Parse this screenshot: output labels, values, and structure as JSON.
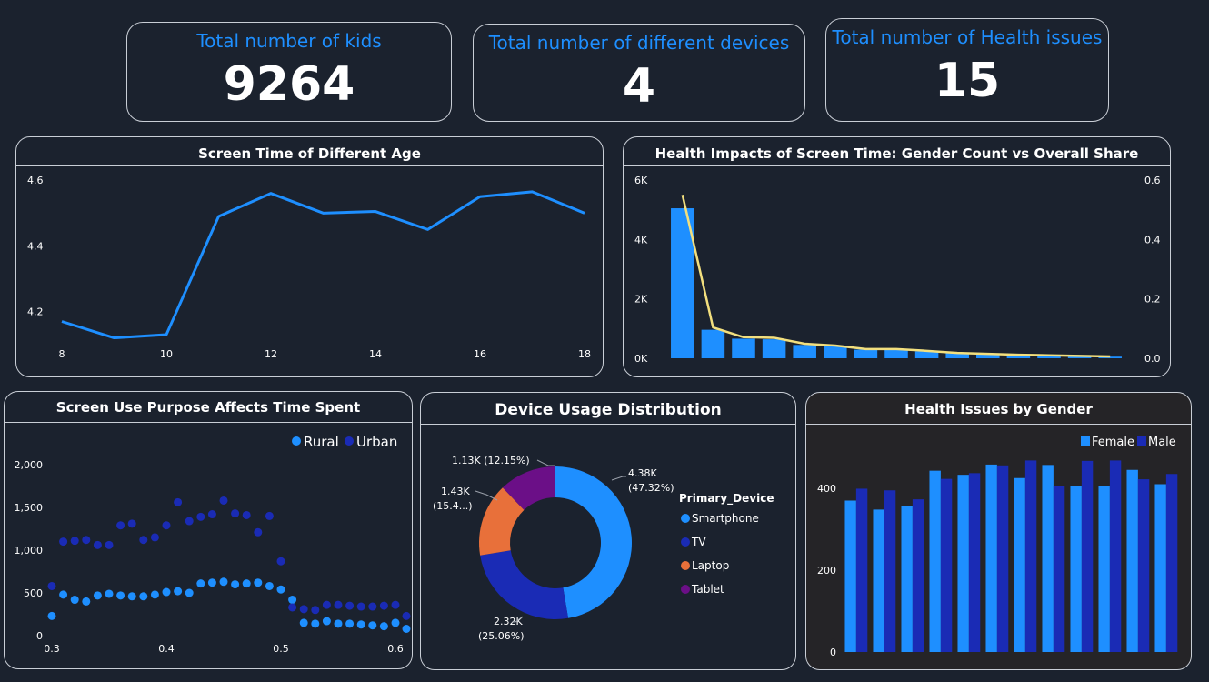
{
  "kpis": [
    {
      "title": "Total number of kids",
      "value": "9264"
    },
    {
      "title": "Total number of different devices",
      "value": "4"
    },
    {
      "title": "Total number of Health issues",
      "value": "15"
    }
  ],
  "colors": {
    "background": "#1b222e",
    "accent": "#1e8fff",
    "urban": "#1a2bb5",
    "line": "#f2df7e",
    "laptop": "#e8703a",
    "tablet": "#6b0f87"
  },
  "chart_data": [
    {
      "id": "screen-time-age",
      "type": "line",
      "title": "Screen Time of Different Age",
      "x": [
        8,
        9,
        10,
        11,
        12,
        13,
        14,
        15,
        16,
        17,
        18
      ],
      "y": [
        4.17,
        4.12,
        4.13,
        4.49,
        4.56,
        4.5,
        4.505,
        4.45,
        4.55,
        4.565,
        4.5
      ],
      "xlim": [
        8,
        18
      ],
      "ylim": [
        4.08,
        4.62
      ],
      "x_ticks": [
        "8",
        "10",
        "12",
        "14",
        "16",
        "18"
      ],
      "y_ticks": [
        "4.2",
        "4.4",
        "4.6"
      ],
      "color": "#1e8fff"
    },
    {
      "id": "health-impacts",
      "type": "bar",
      "title": "Health Impacts of Screen Time: Gender Count vs Overall Share",
      "values": [
        5050,
        960,
        660,
        640,
        450,
        400,
        290,
        285,
        230,
        170,
        140,
        110,
        95,
        75,
        55
      ],
      "share": [
        0.55,
        0.104,
        0.071,
        0.069,
        0.049,
        0.043,
        0.031,
        0.031,
        0.025,
        0.018,
        0.015,
        0.012,
        0.01,
        0.008,
        0.006
      ],
      "ylim": [
        0,
        6000
      ],
      "y2lim": [
        0,
        0.6
      ],
      "y_ticks": [
        "0K",
        "2K",
        "4K",
        "6K"
      ],
      "y2_ticks": [
        "0.0",
        "0.2",
        "0.4",
        "0.6"
      ]
    },
    {
      "id": "purpose-time",
      "type": "scatter",
      "title": "Screen Use Purpose Affects Time Spent",
      "legend": [
        "Rural",
        "Urban"
      ],
      "xlim": [
        0.3,
        0.6
      ],
      "ylim": [
        0,
        2000
      ],
      "x_ticks": [
        "0.3",
        "0.4",
        "0.5",
        "0.6"
      ],
      "y_ticks": [
        "0",
        "500",
        "1,000",
        "1,500",
        "2,000"
      ],
      "series": [
        {
          "name": "Rural",
          "color": "#1e8fff",
          "points": [
            [
              0.3,
              230
            ],
            [
              0.31,
              480
            ],
            [
              0.32,
              420
            ],
            [
              0.33,
              400
            ],
            [
              0.34,
              470
            ],
            [
              0.35,
              490
            ],
            [
              0.36,
              470
            ],
            [
              0.37,
              460
            ],
            [
              0.38,
              460
            ],
            [
              0.39,
              480
            ],
            [
              0.4,
              510
            ],
            [
              0.41,
              520
            ],
            [
              0.42,
              500
            ],
            [
              0.43,
              610
            ],
            [
              0.44,
              620
            ],
            [
              0.45,
              630
            ],
            [
              0.46,
              600
            ],
            [
              0.47,
              610
            ],
            [
              0.48,
              620
            ],
            [
              0.49,
              580
            ],
            [
              0.5,
              540
            ],
            [
              0.51,
              420
            ],
            [
              0.52,
              150
            ],
            [
              0.53,
              140
            ],
            [
              0.54,
              170
            ],
            [
              0.55,
              140
            ],
            [
              0.56,
              140
            ],
            [
              0.57,
              130
            ],
            [
              0.58,
              120
            ],
            [
              0.59,
              110
            ],
            [
              0.6,
              150
            ],
            [
              0.61,
              80
            ]
          ]
        },
        {
          "name": "Urban",
          "color": "#1a2bb5",
          "points": [
            [
              0.3,
              580
            ],
            [
              0.31,
              1100
            ],
            [
              0.32,
              1110
            ],
            [
              0.33,
              1120
            ],
            [
              0.34,
              1060
            ],
            [
              0.35,
              1060
            ],
            [
              0.36,
              1290
            ],
            [
              0.37,
              1310
            ],
            [
              0.38,
              1120
            ],
            [
              0.39,
              1150
            ],
            [
              0.4,
              1290
            ],
            [
              0.41,
              1560
            ],
            [
              0.42,
              1340
            ],
            [
              0.43,
              1390
            ],
            [
              0.44,
              1420
            ],
            [
              0.45,
              1580
            ],
            [
              0.46,
              1430
            ],
            [
              0.47,
              1410
            ],
            [
              0.48,
              1210
            ],
            [
              0.49,
              1400
            ],
            [
              0.5,
              870
            ],
            [
              0.51,
              330
            ],
            [
              0.52,
              310
            ],
            [
              0.53,
              300
            ],
            [
              0.54,
              360
            ],
            [
              0.55,
              360
            ],
            [
              0.56,
              350
            ],
            [
              0.57,
              340
            ],
            [
              0.58,
              340
            ],
            [
              0.59,
              350
            ],
            [
              0.6,
              360
            ],
            [
              0.61,
              230
            ]
          ]
        }
      ]
    },
    {
      "id": "device-usage",
      "type": "pie",
      "title": "Device Usage Distribution",
      "legend_title": "Primary_Device",
      "slices": [
        {
          "name": "Smartphone",
          "value": 47.32,
          "label": "4.38K",
          "pct": "(47.32%)",
          "color": "#1e8fff"
        },
        {
          "name": "TV",
          "value": 25.06,
          "label": "2.32K",
          "pct": "(25.06%)",
          "color": "#1a2bb5"
        },
        {
          "name": "Laptop",
          "value": 15.47,
          "label": "1.43K",
          "pct": "(15.4...)",
          "color": "#e8703a"
        },
        {
          "name": "Tablet",
          "value": 12.15,
          "label": "1.13K (12.15%)",
          "pct": "",
          "color": "#6b0f87"
        }
      ]
    },
    {
      "id": "health-gender",
      "type": "bar",
      "title": "Health Issues by Gender",
      "legend": [
        "Female",
        "Male"
      ],
      "ylim": [
        0,
        500
      ],
      "y_ticks": [
        "0",
        "200",
        "400"
      ],
      "series": [
        {
          "name": "Female",
          "color": "#1e8fff",
          "values": [
            370,
            348,
            357,
            443,
            433,
            458,
            425,
            457,
            406,
            406,
            445,
            410
          ]
        },
        {
          "name": "Male",
          "color": "#1a2bb5",
          "values": [
            399,
            395,
            373,
            423,
            437,
            456,
            468,
            406,
            467,
            468,
            422,
            435
          ]
        }
      ]
    }
  ]
}
